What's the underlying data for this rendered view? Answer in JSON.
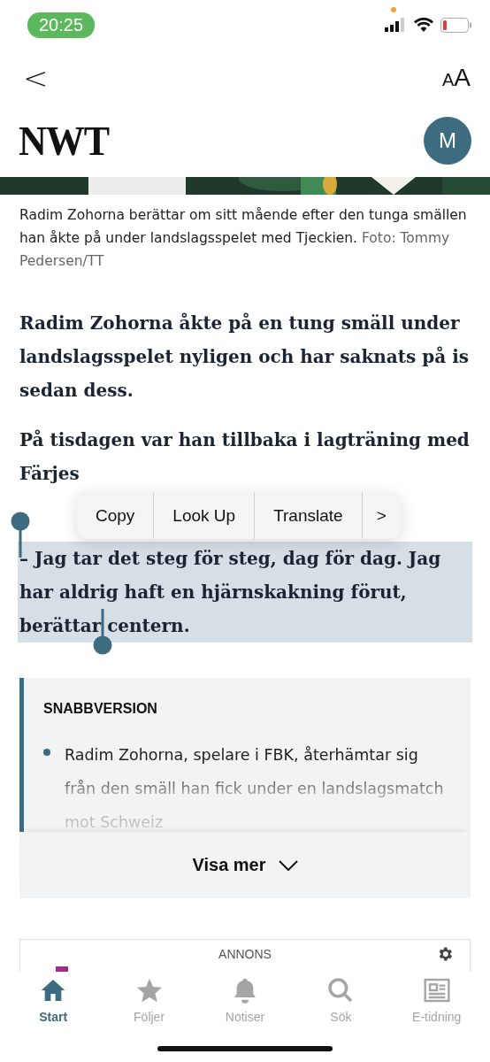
{
  "status_bar": {
    "time": "20:25"
  },
  "nav": {
    "back": "<",
    "font_size": "AA"
  },
  "header": {
    "logo": "NWT",
    "avatar": "M"
  },
  "caption": {
    "text": "Radim Zohorna berättar om sitt mående efter den tunga smällen han åkte på under landslagsspelet med Tjeckien.",
    "credit": "Foto: Tommy Pedersen/TT"
  },
  "paragraphs": [
    {
      "text": "Radim Zohorna åkte på en tung smäll under landslagsspelet nyligen och har saknats på is sedan dess.",
      "highlighted": false
    },
    {
      "text": "På tisdagen var han tillbaka i lagträning med Färjes",
      "highlighted": false
    },
    {
      "text": "– Jag tar det steg för steg, dag för dag. Jag har aldrig haft en hjärnskakning förut, berättar centern.",
      "highlighted": true
    }
  ],
  "context_menu": {
    "items": [
      "Copy",
      "Look Up",
      "Translate"
    ],
    "more": ">"
  },
  "summary": {
    "title": "SNABBVERSION",
    "items": [
      "Radim Zohorna, spelare i FBK, återhämtar sig från den smäll han fick under en landslagsmatch mot Schweiz"
    ],
    "expand": "Visa mer"
  },
  "ad": {
    "label": "ANNONS"
  },
  "tabs": [
    {
      "label": "Start",
      "selected": true,
      "kind": "home"
    },
    {
      "label": "Följer",
      "selected": false,
      "kind": "star"
    },
    {
      "label": "Notiser",
      "selected": false,
      "kind": "bell"
    },
    {
      "label": "Sök",
      "selected": false,
      "kind": "search"
    },
    {
      "label": "E-tidning",
      "selected": false,
      "kind": "paper"
    }
  ]
}
